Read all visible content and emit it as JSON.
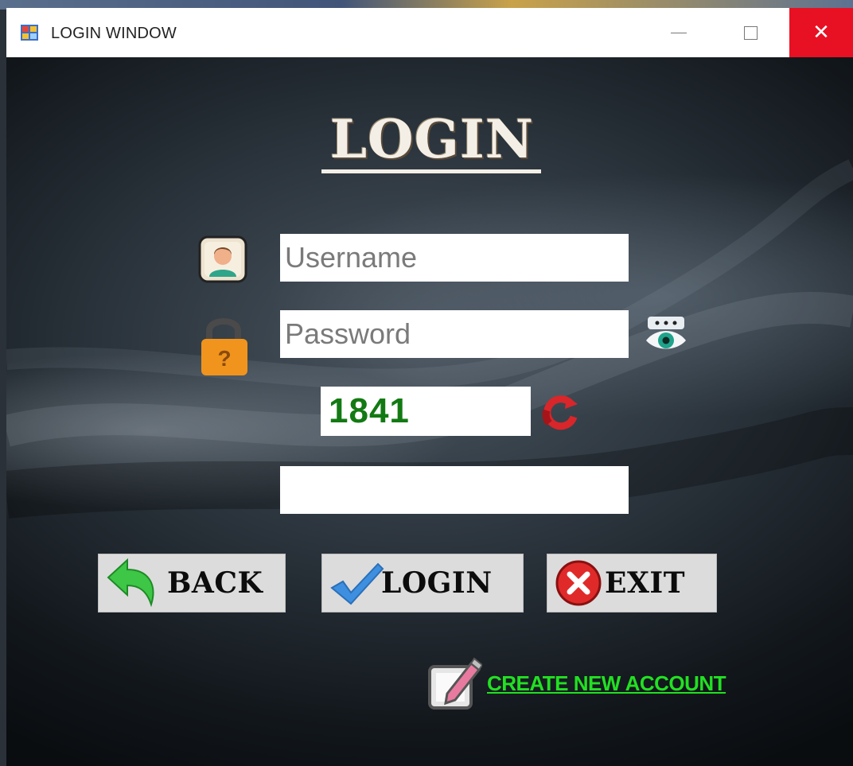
{
  "window": {
    "title": "LOGIN WINDOW",
    "close_glyph": "✕"
  },
  "login": {
    "heading": "LOGIN",
    "username_placeholder": "Username",
    "password_placeholder": "Password",
    "captcha_code": "1841",
    "captcha_input_value": ""
  },
  "buttons": {
    "back_label": "BACK",
    "login_label": "LOGIN",
    "exit_label": "EXIT"
  },
  "links": {
    "create_account": "CREATE NEW ACCOUNT"
  },
  "icons": [
    "app-icon",
    "user-icon",
    "lock-icon",
    "eye-icon",
    "refresh-icon",
    "back-arrow-icon",
    "checkmark-icon",
    "exit-x-icon",
    "edit-icon"
  ],
  "colors": {
    "close_button": "#e81123",
    "captcha_text": "#137a13",
    "link": "#22e022"
  }
}
